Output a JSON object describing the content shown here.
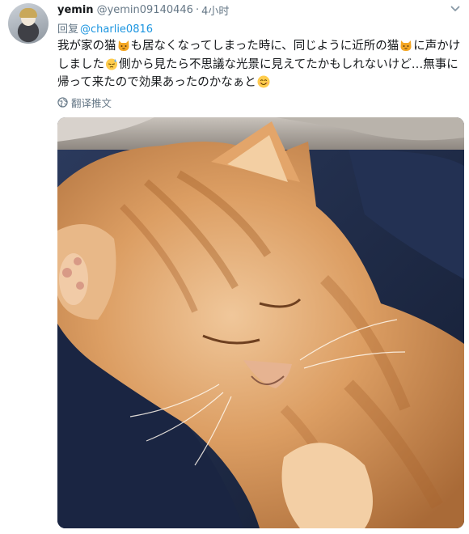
{
  "tweet": {
    "author_name": "yemin",
    "author_handle": "@yemin09140446",
    "separator": "·",
    "timestamp": "4小时",
    "reply_prefix": "回复",
    "reply_to": "@charlie0816",
    "text_part1": "我が家の猫",
    "text_part2": "も居なくなってしまった時に、同じように近所の猫",
    "text_part3": "に声かけしました",
    "text_part4": "側から見たら不思議な光景に見えてたかもしれないけど…無事に帰って来たので効果あったのかなぁと",
    "translate_label": "翻译推文",
    "icons": {
      "menu": "chevron-down-icon",
      "translate": "globe-icon",
      "emoji_cat": "cat-face-emoji",
      "emoji_sweat": "downcast-sweat-emoji",
      "emoji_smile": "smiling-face-emoji"
    }
  }
}
